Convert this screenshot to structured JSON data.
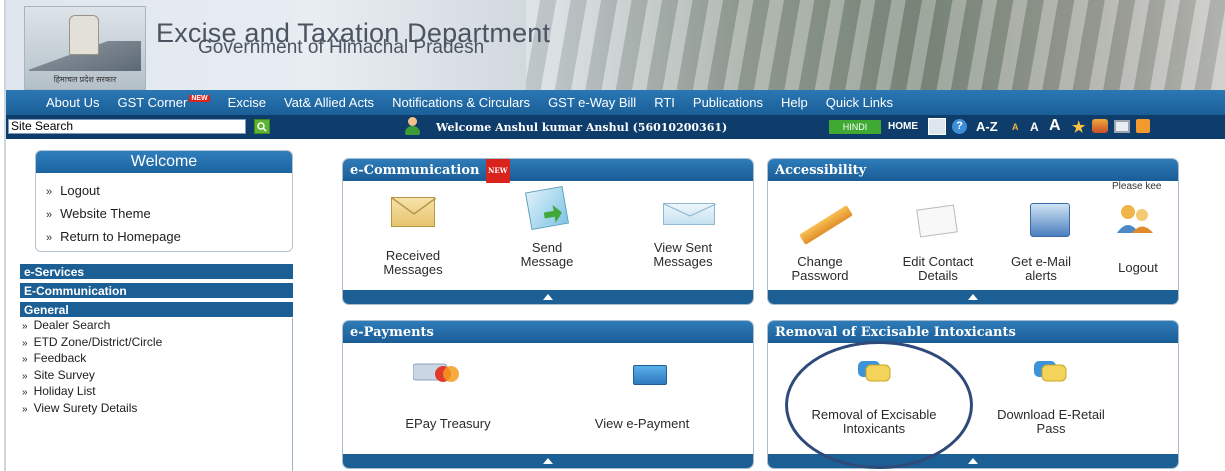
{
  "header": {
    "title": "Excise and Taxation Department",
    "subtitle": "Government of Himachal Pradesh",
    "emblem_caption": "हिमाचल प्रदेश सरकार"
  },
  "nav": {
    "items": [
      {
        "label": "About Us"
      },
      {
        "label": "GST Corner",
        "badge": "NEW"
      },
      {
        "label": "Excise"
      },
      {
        "label": "Vat& Allied Acts"
      },
      {
        "label": "Notifications & Circulars"
      },
      {
        "label": "GST e-Way Bill"
      },
      {
        "label": "RTI"
      },
      {
        "label": "Publications"
      },
      {
        "label": "Help"
      },
      {
        "label": "Quick Links"
      }
    ]
  },
  "toolbar": {
    "search_value": "Site Search",
    "welcome": "Welcome  Anshul kumar Anshul (56010200361)",
    "hindi": "HINDI",
    "home": "HOME",
    "az": "A-Z",
    "font_small": "A",
    "font_medium": "A",
    "font_large": "A"
  },
  "sidebar": {
    "welcome_title": "Welcome",
    "welcome_items": [
      "Logout",
      "Website Theme",
      "Return to Homepage"
    ],
    "eservices": "e-Services",
    "ecommunication": "E-Communication",
    "general": "General",
    "general_items": [
      "Dealer Search",
      "ETD Zone/District/Circle",
      "Feedback",
      "Site Survey",
      "Holiday List",
      "View Surety Details"
    ]
  },
  "panels": {
    "ecomm": {
      "title": "e-Communication",
      "badge": "NEW",
      "items": [
        "Received Messages",
        "Send Message",
        "View Sent Messages"
      ]
    },
    "accessibility": {
      "title": "Accessibility",
      "note": "Please kee",
      "items": [
        "Change Password",
        "Edit Contact Details",
        "Get e-Mail alerts",
        "Logout"
      ]
    },
    "epayments": {
      "title": "e-Payments",
      "items": [
        "EPay Treasury",
        "View e-Payment"
      ]
    },
    "removal": {
      "title": "Removal of Excisable Intoxicants",
      "items": [
        "Removal of Excisable Intoxicants",
        "Download E-Retail Pass"
      ]
    }
  },
  "colors": {
    "nav_blue": "#1a5f97",
    "dark_blue": "#0f3d6b",
    "new_badge": "#d9231c",
    "hindi_green": "#3fa934"
  }
}
